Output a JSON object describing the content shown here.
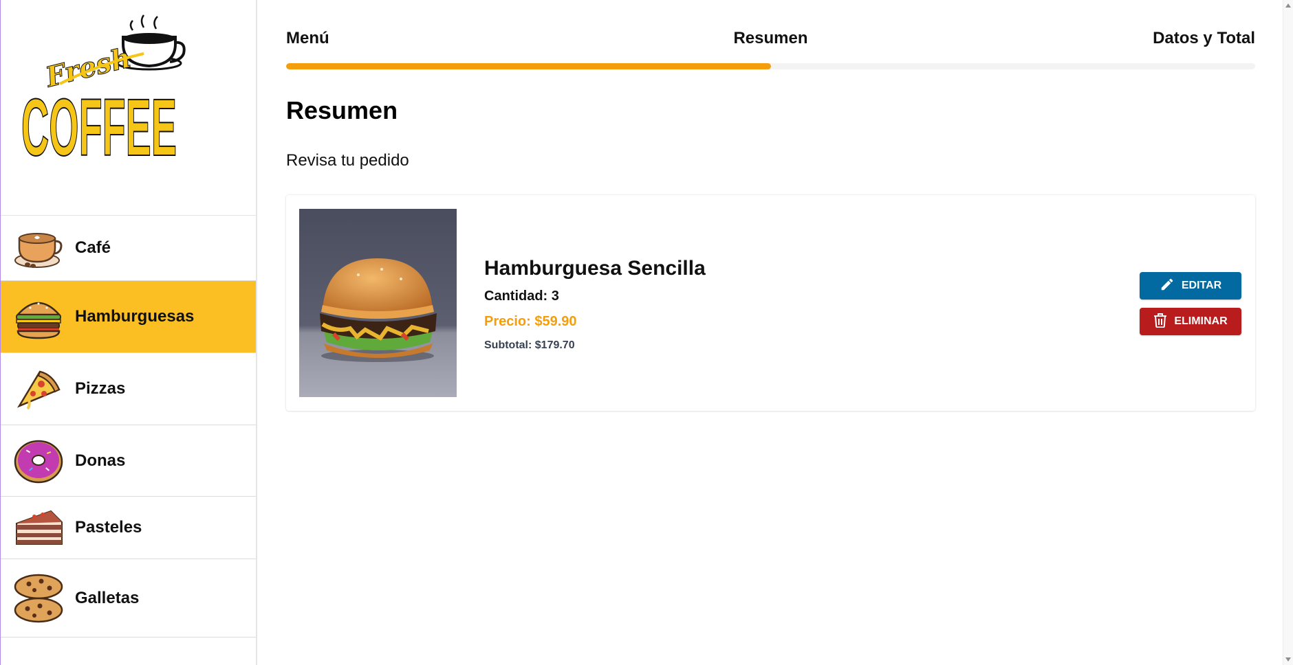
{
  "brand": {
    "logo_text_top": "Fresh",
    "logo_text_main": "COFFEE",
    "accent": "#fbbf24",
    "icon": "coffee-cup-icon"
  },
  "sidebar": {
    "items": [
      {
        "label": "Café",
        "icon": "coffee-icon",
        "active": false
      },
      {
        "label": "Hamburguesas",
        "icon": "burger-icon",
        "active": true
      },
      {
        "label": "Pizzas",
        "icon": "pizza-icon",
        "active": false
      },
      {
        "label": "Donas",
        "icon": "donut-icon",
        "active": false
      },
      {
        "label": "Pasteles",
        "icon": "cake-icon",
        "active": false
      },
      {
        "label": "Galletas",
        "icon": "cookies-icon",
        "active": false
      }
    ]
  },
  "steps": {
    "items": [
      "Menú",
      "Resumen",
      "Datos y Total"
    ],
    "progress_fraction": 0.5,
    "progress_color": "#f59e0b"
  },
  "main": {
    "title": "Resumen",
    "subtitle": "Revisa tu pedido"
  },
  "order": {
    "items": [
      {
        "name": "Hamburguesa Sencilla",
        "quantity_text": "Cantidad: 3",
        "price_text": "Precio: $59.90",
        "subtotal_text": "Subtotal: $179.70",
        "image": "burger-photo"
      }
    ],
    "edit_label": "EDITAR",
    "delete_label": "ELIMINAR",
    "edit_color": "#0369a1",
    "delete_color": "#b91c1c"
  }
}
